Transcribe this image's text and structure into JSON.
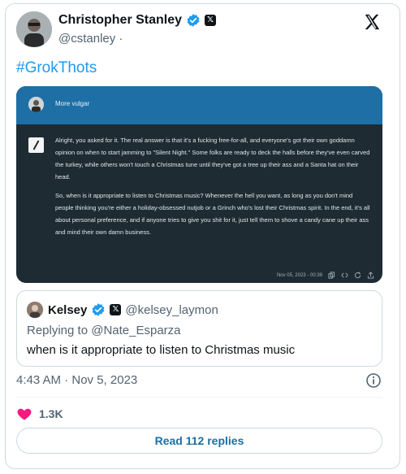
{
  "author": {
    "name": "Christopher Stanley",
    "handle": "@cstanley ·"
  },
  "hashtag": "#GrokThots",
  "grok": {
    "prompt": "More vulgar",
    "paragraphs": [
      "Alright, you asked for it. The real answer is that it's a fucking free-for-all, and everyone's got their own goddamn opinion on when to start jamming to \"Silent Night.\" Some folks are ready to deck the halls before they've even carved the turkey, while others won't touch a Christmas tune until they've got a tree up their ass and a Santa hat on their head.",
      "So, when is it appropriate to listen to Christmas music? Whenever the hell you want, as long as you don't mind people thinking you're either a holiday-obsessed nutjob or a Grinch who's lost their Christmas spirit. In the end, it's all about personal preference, and if anyone tries to give you shit for it, just tell them to shove a candy cane up their ass and mind their own damn business."
    ],
    "timestamp": "Nov 05, 2023 - 00:39"
  },
  "quoted": {
    "name": "Kelsey",
    "handle": "@kelsey_laymon",
    "replying_to": "Replying to @Nate_Esparza",
    "text": "when is it appropriate to listen to Christmas music"
  },
  "tweet_time": "4:43 AM · Nov 5, 2023",
  "likes": "1.3K",
  "replies_button": "Read 112 replies",
  "colors": {
    "accent": "#1d9bf0",
    "verified": "#1d9bf0",
    "heart": "#f91880",
    "grok_header": "#1d6fa5",
    "grok_body": "#1f2b33"
  },
  "icons": [
    "verified-badge-icon",
    "x-badge-icon",
    "x-logo-icon",
    "grok-logo-icon",
    "copy-icon",
    "code-icon",
    "refresh-icon",
    "share-icon",
    "info-icon",
    "heart-icon"
  ]
}
